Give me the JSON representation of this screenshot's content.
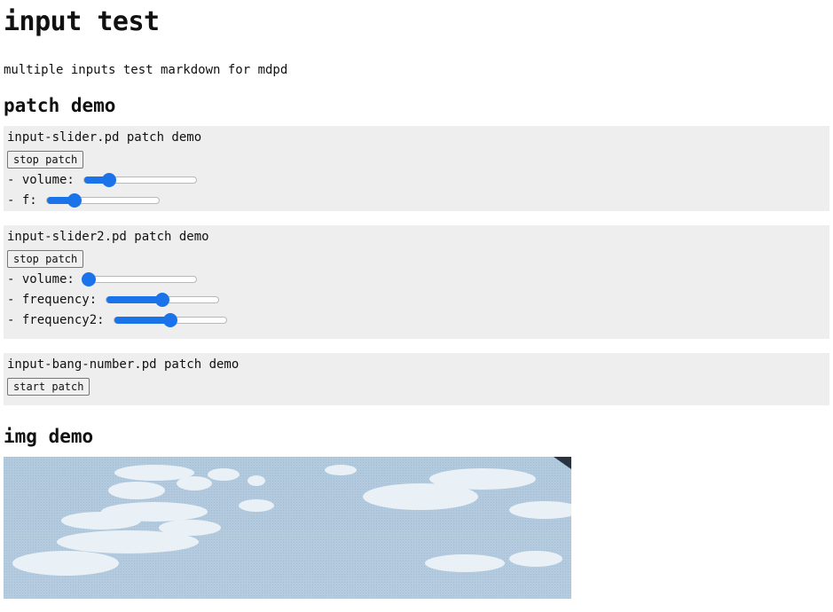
{
  "title": "input test",
  "intro": "multiple inputs test markdown for mdpd",
  "patch_heading": "patch demo",
  "patches": [
    {
      "title": "input-slider.pd patch demo",
      "button": "stop patch",
      "controls": [
        {
          "label": "- volume:",
          "value": 0.22
        },
        {
          "label": "- f:",
          "value": 0.25
        }
      ]
    },
    {
      "title": "input-slider2.pd patch demo",
      "button": "stop patch",
      "controls": [
        {
          "label": "- volume:",
          "value": 0.04
        },
        {
          "label": "- frequency:",
          "value": 0.5
        },
        {
          "label": "- frequency2:",
          "value": 0.5
        }
      ]
    },
    {
      "title": "input-bang-number.pd patch demo",
      "button": "start patch",
      "controls": []
    }
  ],
  "img_heading": "img demo",
  "colors": {
    "accent": "#1a73e8",
    "panel": "#eeeeee"
  }
}
